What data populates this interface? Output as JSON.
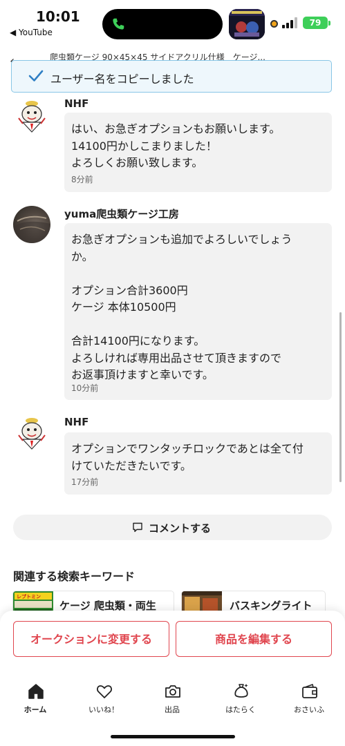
{
  "status_bar": {
    "time": "10:01",
    "back_app": "◀ YouTube",
    "battery": "79"
  },
  "header": {
    "item_title": "爬虫類ケージ 90×45×45 サイドアクリル仕様　ケージ..."
  },
  "toast": {
    "message": "ユーザー名をコピーしました"
  },
  "comments": [
    {
      "user": "NHF",
      "text": "はい、お急ぎオプションもお願いします。\n14100円かしこまりました！\nよろしくお願い致します。",
      "time": "8分前"
    },
    {
      "user": "yuma爬虫類ケージ工房",
      "text": "お急ぎオプションも追加でよろしいでしょう\nか。\n\nオプション合計3600円\nケージ 本体10500円\n\n合計14100円になります。\nよろしければ専用出品させて頂きますので\nお返事頂けますと幸いです。",
      "time": "10分前"
    },
    {
      "user": "NHF",
      "text": "オプションでワンタッチロックであとは全て付\nけていただきたいです。",
      "time": "17分前"
    }
  ],
  "comment_button": {
    "label": "コメントする"
  },
  "related": {
    "title": "関連する検索キーワード",
    "keywords": [
      {
        "label": "ケージ 爬虫類・両生",
        "img_text": "レプトミン"
      },
      {
        "label": "バスキングライト"
      }
    ]
  },
  "actions": {
    "auction": "オークションに変更する",
    "edit": "商品を編集する"
  },
  "bottom_nav": [
    {
      "label": "ホーム",
      "icon": "home-icon",
      "active": true
    },
    {
      "label": "いいね！",
      "icon": "heart-icon",
      "active": false
    },
    {
      "label": "出品",
      "icon": "camera-icon",
      "active": false
    },
    {
      "label": "はたらく",
      "icon": "money-bag-icon",
      "active": false
    },
    {
      "label": "おさいふ",
      "icon": "wallet-icon",
      "active": false
    }
  ],
  "colors": {
    "accent_red": "#e0454e",
    "toast_border": "#88c6e6",
    "toast_check": "#2f7fc4",
    "bubble_bg": "#f2f2f2",
    "battery_green": "#3ecf59"
  }
}
